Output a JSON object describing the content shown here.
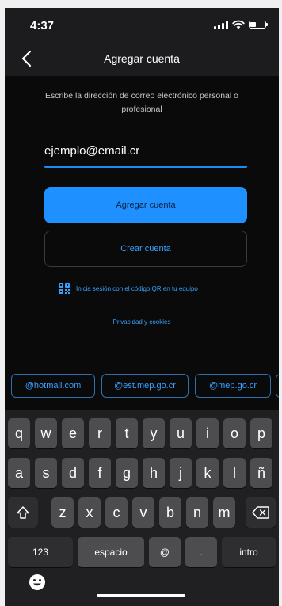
{
  "status_bar": {
    "time": "4:37"
  },
  "navbar": {
    "title": "Agregar cuenta"
  },
  "content": {
    "instructions": "Escribe la dirección de correo electrónico personal o profesional",
    "email_value": "ejemplo@email.cr",
    "primary_button": "Agregar cuenta",
    "secondary_button": "Crear cuenta",
    "qr_link": "Inicia sesión con el código QR en tu equipo",
    "privacy_link": "Privacidad y cookies"
  },
  "suggestions": [
    "@hotmail.com",
    "@est.mep.go.cr",
    "@mep.go.cr"
  ],
  "keyboard": {
    "row1": [
      "q",
      "w",
      "e",
      "r",
      "t",
      "y",
      "u",
      "i",
      "o",
      "p"
    ],
    "row2": [
      "a",
      "s",
      "d",
      "f",
      "g",
      "h",
      "j",
      "k",
      "l",
      "ñ"
    ],
    "row3": [
      "z",
      "x",
      "c",
      "v",
      "b",
      "n",
      "m"
    ],
    "row4": {
      "numbers": "123",
      "space": "espacio",
      "at": "@",
      "dot": ".",
      "return": "intro"
    }
  },
  "colors": {
    "accent": "#1e90ff",
    "link": "#3aa0ff",
    "background": "#0a0a0b",
    "keyboard": "#202022",
    "key": "#4d4d50"
  },
  "icons": [
    "back-chevron-icon",
    "signal-icon",
    "wifi-icon",
    "battery-icon",
    "qr-code-icon",
    "shift-icon",
    "delete-icon",
    "emoji-icon"
  ]
}
